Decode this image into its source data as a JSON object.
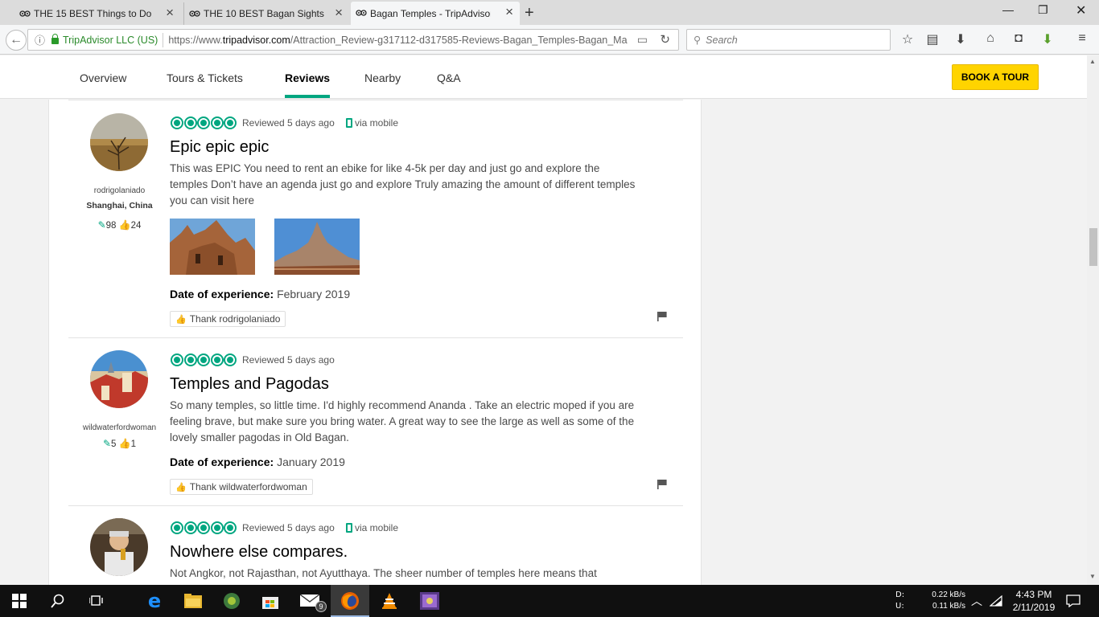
{
  "browser": {
    "tabs": [
      {
        "title": "THE 15 BEST Things to Do i...",
        "active": false
      },
      {
        "title": "THE 10 BEST Bagan Sights ...",
        "active": false
      },
      {
        "title": "Bagan Temples - TripAdvisor",
        "active": true
      }
    ],
    "url": {
      "org": "TripAdvisor LLC (US)",
      "prefix": "https://www.",
      "domain": "tripadvisor.com",
      "path": "/Attraction_Review-g317112-d317585-Reviews-Bagan_Temples-Bagan_Ma"
    },
    "search_placeholder": "Search"
  },
  "subnav": {
    "items": [
      "Overview",
      "Tours & Tickets",
      "Reviews",
      "Nearby",
      "Q&A"
    ],
    "active": "Reviews",
    "book_button": "BOOK A TOUR"
  },
  "reviews": [
    {
      "username": "rodrigolaniado",
      "location": "Shanghai, China",
      "contributions": "98",
      "helpful_votes": "24",
      "rating": 5,
      "reviewed": "Reviewed 5 days ago",
      "via": "via mobile",
      "title": "Epic epic epic",
      "body": "This was EPIC You need to rent an ebike for like 4-5k per day and just go and explore the temples Don’t have an agenda just go and explore Truly amazing the amount of different temples you can visit here",
      "date_label": "Date of experience:",
      "date_value": "February 2019",
      "thank": "Thank rodrigolaniado"
    },
    {
      "username": "wildwaterfordwoman",
      "location": "",
      "contributions": "5",
      "helpful_votes": "1",
      "rating": 5,
      "reviewed": "Reviewed 5 days ago",
      "via": "",
      "title": "Temples and Pagodas",
      "body": "So many temples, so little time. I'd highly recommend Ananda . Take an electric moped if you are feeling brave, but make sure you bring water. A great way to see the large as well as some of the lovely smaller pagodas in Old Bagan.",
      "date_label": "Date of experience:",
      "date_value": "January 2019",
      "thank": "Thank wildwaterfordwoman"
    },
    {
      "username": "",
      "location": "",
      "rating": 5,
      "reviewed": "Reviewed 5 days ago",
      "via": "via mobile",
      "title": "Nowhere else compares.",
      "body": "Not Angkor, not Rajasthan, not Ayutthaya. The sheer number of temples here means that"
    }
  ],
  "taskbar": {
    "net_labels": "D:\nU:",
    "net_down": "0.22 kB/s",
    "net_up": "0.11 kB/s",
    "time": "4:43 PM",
    "date": "2/11/2019",
    "mail_badge": "9"
  },
  "colors": {
    "tripadvisor_green": "#00a680",
    "book_yellow": "#ffd400"
  }
}
